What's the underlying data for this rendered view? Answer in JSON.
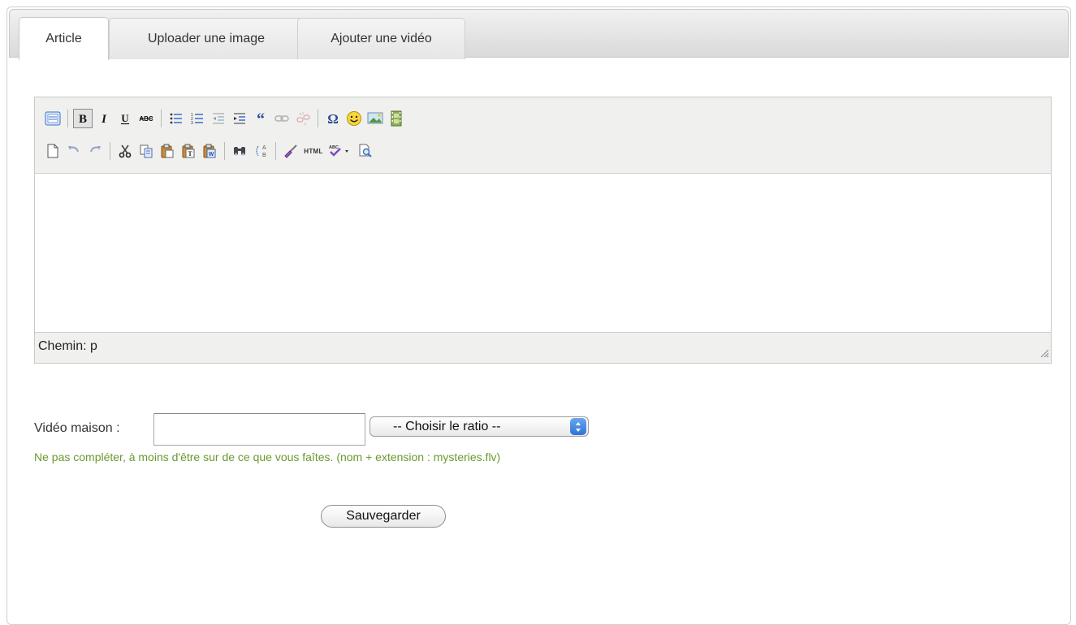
{
  "tabs": [
    {
      "label": "Article",
      "active": true
    },
    {
      "label": "Uploader une image",
      "active": false
    },
    {
      "label": "Ajouter une vidéo",
      "active": false
    }
  ],
  "editor": {
    "toolbar_row1": [
      "toggle-html-icon",
      "bold-icon",
      "italic-icon",
      "underline-icon",
      "strikethrough-icon",
      "bullet-list-icon",
      "numbered-list-icon",
      "outdent-icon",
      "indent-icon",
      "blockquote-icon",
      "link-icon",
      "unlink-icon",
      "special-char-icon",
      "emoticon-icon",
      "image-icon",
      "media-icon"
    ],
    "toolbar_row2": [
      "new-document-icon",
      "undo-icon",
      "redo-icon",
      "cut-icon",
      "copy-icon",
      "paste-icon",
      "paste-text-icon",
      "paste-word-icon",
      "find-icon",
      "replace-icon",
      "cleanup-icon",
      "html-source-icon",
      "spellcheck-icon",
      "preview-icon"
    ],
    "bold_pressed": true,
    "path_label": "Chemin: p",
    "html_button_label": "HTML"
  },
  "form": {
    "video_label": "Vidéo maison :",
    "video_value": "",
    "ratio_selected": "-- Choisir le ratio --",
    "hint": "Ne pas compléter, à moins d'être sur de ce que vous faîtes. (nom + extension : mysteries.flv)",
    "save_label": "Sauvegarder"
  },
  "colors": {
    "hint_green": "#6b9a2e",
    "toolbar_bg": "#f0f0ee",
    "select_arrow_blue": "#2f74d6"
  }
}
